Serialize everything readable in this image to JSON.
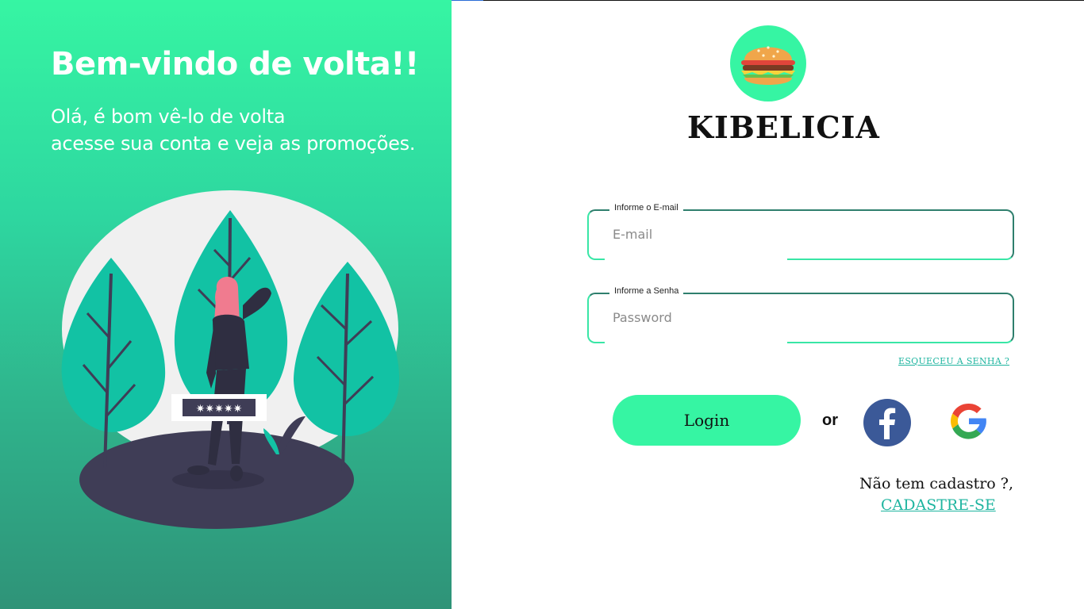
{
  "welcome": {
    "title": "Bem-vindo de volta!!",
    "subtitle_line1": "Olá, é bom vê-lo de volta",
    "subtitle_line2": "acesse sua conta e veja as promoções."
  },
  "illustration": {
    "password_mask": "✷✷✷✷✷"
  },
  "brand": {
    "name": "KIBELICIA",
    "logo_icon": "burger-icon"
  },
  "form": {
    "email_label": "Informe o E-mail",
    "email_placeholder": "E-mail",
    "password_label": "Informe a  Senha",
    "password_placeholder": "Password",
    "forgot_link": "ESQUECEU A SENHA ?",
    "login_label": "Login",
    "or_label": "or"
  },
  "social": {
    "facebook_icon": "facebook-icon",
    "google_icon": "google-icon"
  },
  "signup": {
    "prompt": "Não tem cadastro ?,",
    "link": "CADASTRE-SE"
  },
  "colors": {
    "accent": "#36f5a3",
    "link": "#1fb5a0",
    "field_border_top": "#2f7f6d",
    "facebook": "#3b5998"
  }
}
